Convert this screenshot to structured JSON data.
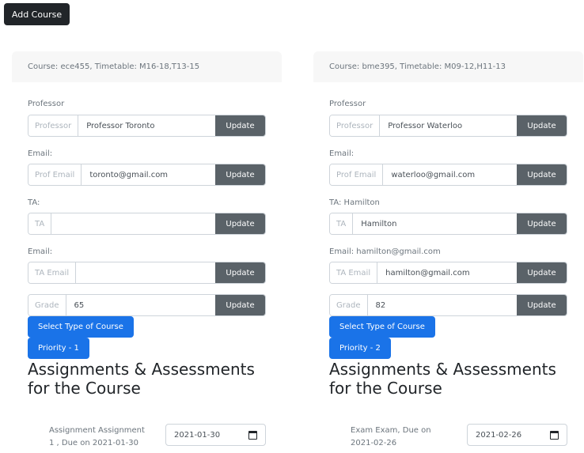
{
  "toolbar": {
    "add_course_label": "Add Course"
  },
  "cards": [
    {
      "header": "Course: ece455, Timetable: M16-18,T13-15",
      "professor_label": "Professor",
      "professor_prefix": "Professor",
      "professor_value": "Professor Toronto",
      "prof_email_label": "Email:",
      "prof_email_prefix": "Prof Email",
      "prof_email_value": "toronto@gmail.com",
      "ta_label": "TA:",
      "ta_prefix": "TA",
      "ta_value": "",
      "ta_email_label": "Email:",
      "ta_email_prefix": "TA Email",
      "ta_email_value": "",
      "grade_prefix": "Grade",
      "grade_value": "65",
      "update_label": "Update",
      "type_button": "Select Type of Course",
      "priority_button": "Priority - 1",
      "heading": "Assignments & Assessments for the Course",
      "assignment_text": "Assignment Assignment 1 , Due on 2021-01-30",
      "assignment_date": "2021-01-30"
    },
    {
      "header": "Course: bme395, Timetable: M09-12,H11-13",
      "professor_label": "Professor",
      "professor_prefix": "Professor",
      "professor_value": "Professor Waterloo",
      "prof_email_label": "Email:",
      "prof_email_prefix": "Prof Email",
      "prof_email_value": "waterloo@gmail.com",
      "ta_label": "TA: Hamilton",
      "ta_prefix": "TA",
      "ta_value": "Hamilton",
      "ta_email_label": "Email: hamilton@gmail.com",
      "ta_email_prefix": "TA Email",
      "ta_email_value": "hamilton@gmail.com",
      "grade_prefix": "Grade",
      "grade_value": "82",
      "update_label": "Update",
      "type_button": "Select Type of Course",
      "priority_button": "Priority - 2",
      "heading": "Assignments & Assessments for the Course",
      "assignment_text": "Exam Exam, Due on 2021-02-26",
      "assignment_date": "2021-02-26"
    }
  ],
  "icons": {
    "calendar": "calendar-icon"
  },
  "colors": {
    "primary": "#1a73e8",
    "dark": "#212529",
    "secondary": "#5a6268"
  }
}
